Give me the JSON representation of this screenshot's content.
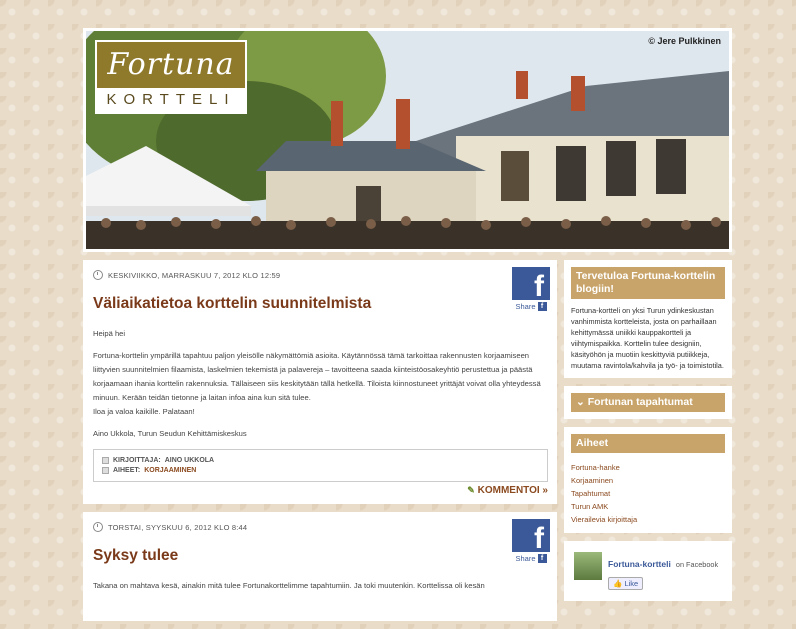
{
  "header": {
    "copyright": "© Jere Pulkkinen",
    "logo_script": "Fortuna",
    "logo_caps": "KORTTELI"
  },
  "posts": [
    {
      "date": "KESKIVIIKKO, MARRASKUU 7, 2012 KLO 12:59",
      "title": "Väliaikatietoa korttelin suunnitelmista",
      "share_label": "Share",
      "paragraphs": [
        "Heipä hei",
        "Fortuna-korttelin ympärillä tapahtuu paljon yleisölle näkymättömiä asioita. Käytännössä tämä tarkoittaa rakennusten korjaamiseen liittyvien suunnitelmien filaamista, laskelmien tekemistä ja palavereja – tavoitteena saada kiinteistöosakeyhtiö perustettua ja päästä korjaamaan ihania korttelin rakennuksia. Tällaiseen siis keskitytään tällä hetkellä. Tiloista kiinnostuneet yrittäjät voivat olla yhteydessä minuun. Kerään teidän tietonne ja laitan infoa aina kun sitä tulee.\nIloa ja valoa kaikille. Palataan!",
        "Aino Ukkola, Turun Seudun Kehittämiskeskus"
      ],
      "author_label": "KIRJOITTAJA:",
      "author": "AINO UKKOLA",
      "tags_label": "AIHEET:",
      "tags": "KORJAAMINEN",
      "comment_link": "KOMMENTOI »"
    },
    {
      "date": "TORSTAI, SYYSKUU 6, 2012 KLO 8:44",
      "title": "Syksy tulee",
      "share_label": "Share",
      "paragraphs": [
        "Takana on mahtava kesä, ainakin mitä tulee Fortunakorttelimme tapahtumiin. Ja toki muutenkin. Korttelissa oli kesän"
      ]
    }
  ],
  "sidebar": {
    "welcome_title": "Tervetuloa Fortuna-korttelin blogiin!",
    "welcome_text": "Fortuna-kortteli on yksi Turun ydinkeskustan vanhimmista kortteleista, josta on parhaillaan kehittymässä uniikki kauppakortteli ja viihtymispaikka. Korttelin tulee designiin, käsityöhön ja muotiin keskittyviä putiikkeja, muutama ravintola/kahvila ja työ- ja toimistotila.",
    "events_title": "Fortunan tapahtumat",
    "topics_title": "Aiheet",
    "topics": [
      "Fortuna-hanke",
      "Korjaaminen",
      "Tapahtumat",
      "Turun AMK",
      "Vierailevia kirjoittaja"
    ],
    "fb_name": "Fortuna-kortteli",
    "fb_on": "on Facebook",
    "fb_like": "Like"
  }
}
